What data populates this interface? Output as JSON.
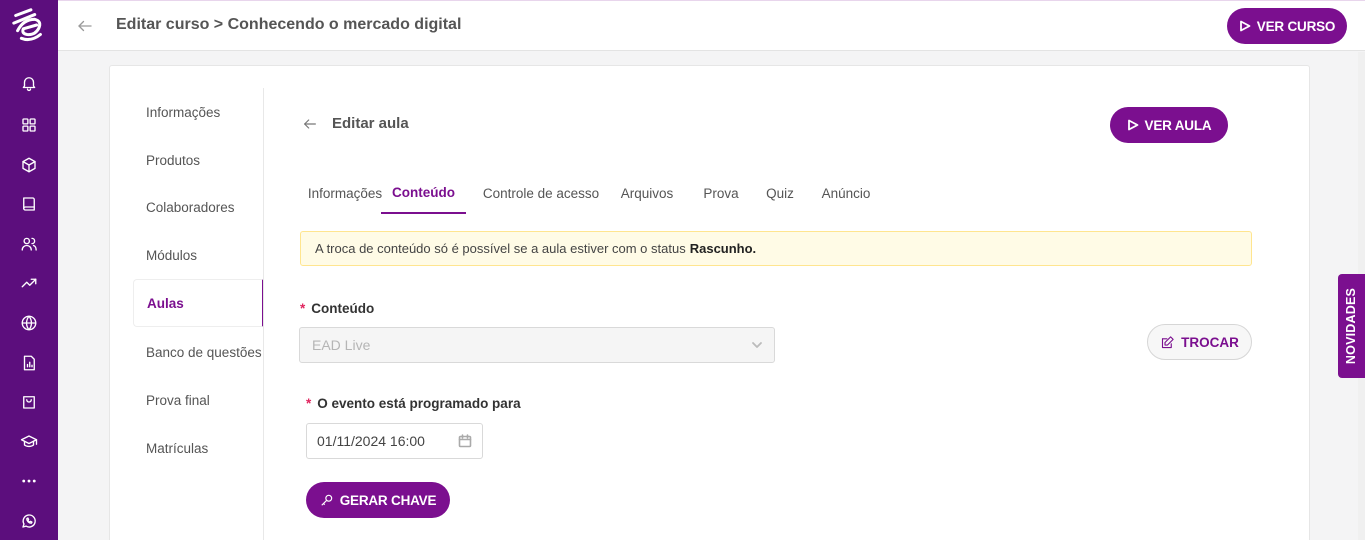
{
  "header": {
    "title": "Editar curso > Conhecendo o mercado digital",
    "ver_curso_label": "VER CURSO"
  },
  "sidebar_rail": {
    "icons": [
      "logo-icon",
      "bell-icon",
      "grid-icon",
      "box-icon",
      "book-icon",
      "users-icon",
      "trending-up-icon",
      "globe-icon",
      "report-icon",
      "shopping-bag-icon",
      "graduation-cap-icon",
      "more-icon",
      "whatsapp-icon"
    ]
  },
  "course_nav": {
    "items": [
      {
        "label": "Informações"
      },
      {
        "label": "Produtos"
      },
      {
        "label": "Colaboradores"
      },
      {
        "label": "Módulos"
      },
      {
        "label": "Aulas"
      },
      {
        "label": "Banco de questões"
      },
      {
        "label": "Prova final"
      },
      {
        "label": "Matrículas"
      }
    ],
    "active": "Aulas"
  },
  "lesson": {
    "title": "Editar aula",
    "ver_aula_label": "VER AULA",
    "tabs": [
      {
        "label": "Informações"
      },
      {
        "label": "Conteúdo"
      },
      {
        "label": "Controle de acesso"
      },
      {
        "label": "Arquivos"
      },
      {
        "label": "Prova"
      },
      {
        "label": "Quiz"
      },
      {
        "label": "Anúncio"
      }
    ],
    "active_tab": "Conteúdo",
    "alert": {
      "text": "A troca de conteúdo só é possível se a aula estiver com o status",
      "status": "Rascunho."
    },
    "content_field": {
      "required_mark": "*",
      "label": "Conteúdo",
      "value": "EAD Live"
    },
    "trocar_label": "TROCAR",
    "event_field": {
      "required_mark": "*",
      "label": "O evento está programado para",
      "value": "01/11/2024 16:00"
    },
    "gerar_chave_label": "GERAR CHAVE"
  },
  "novidades_label": "NOVIDADES",
  "colors": {
    "brand": "#7b0f8f",
    "rail": "#5c0e7d",
    "alert_bg": "#fffbe6",
    "alert_border": "#ffe58f",
    "required": "#e0245e"
  }
}
